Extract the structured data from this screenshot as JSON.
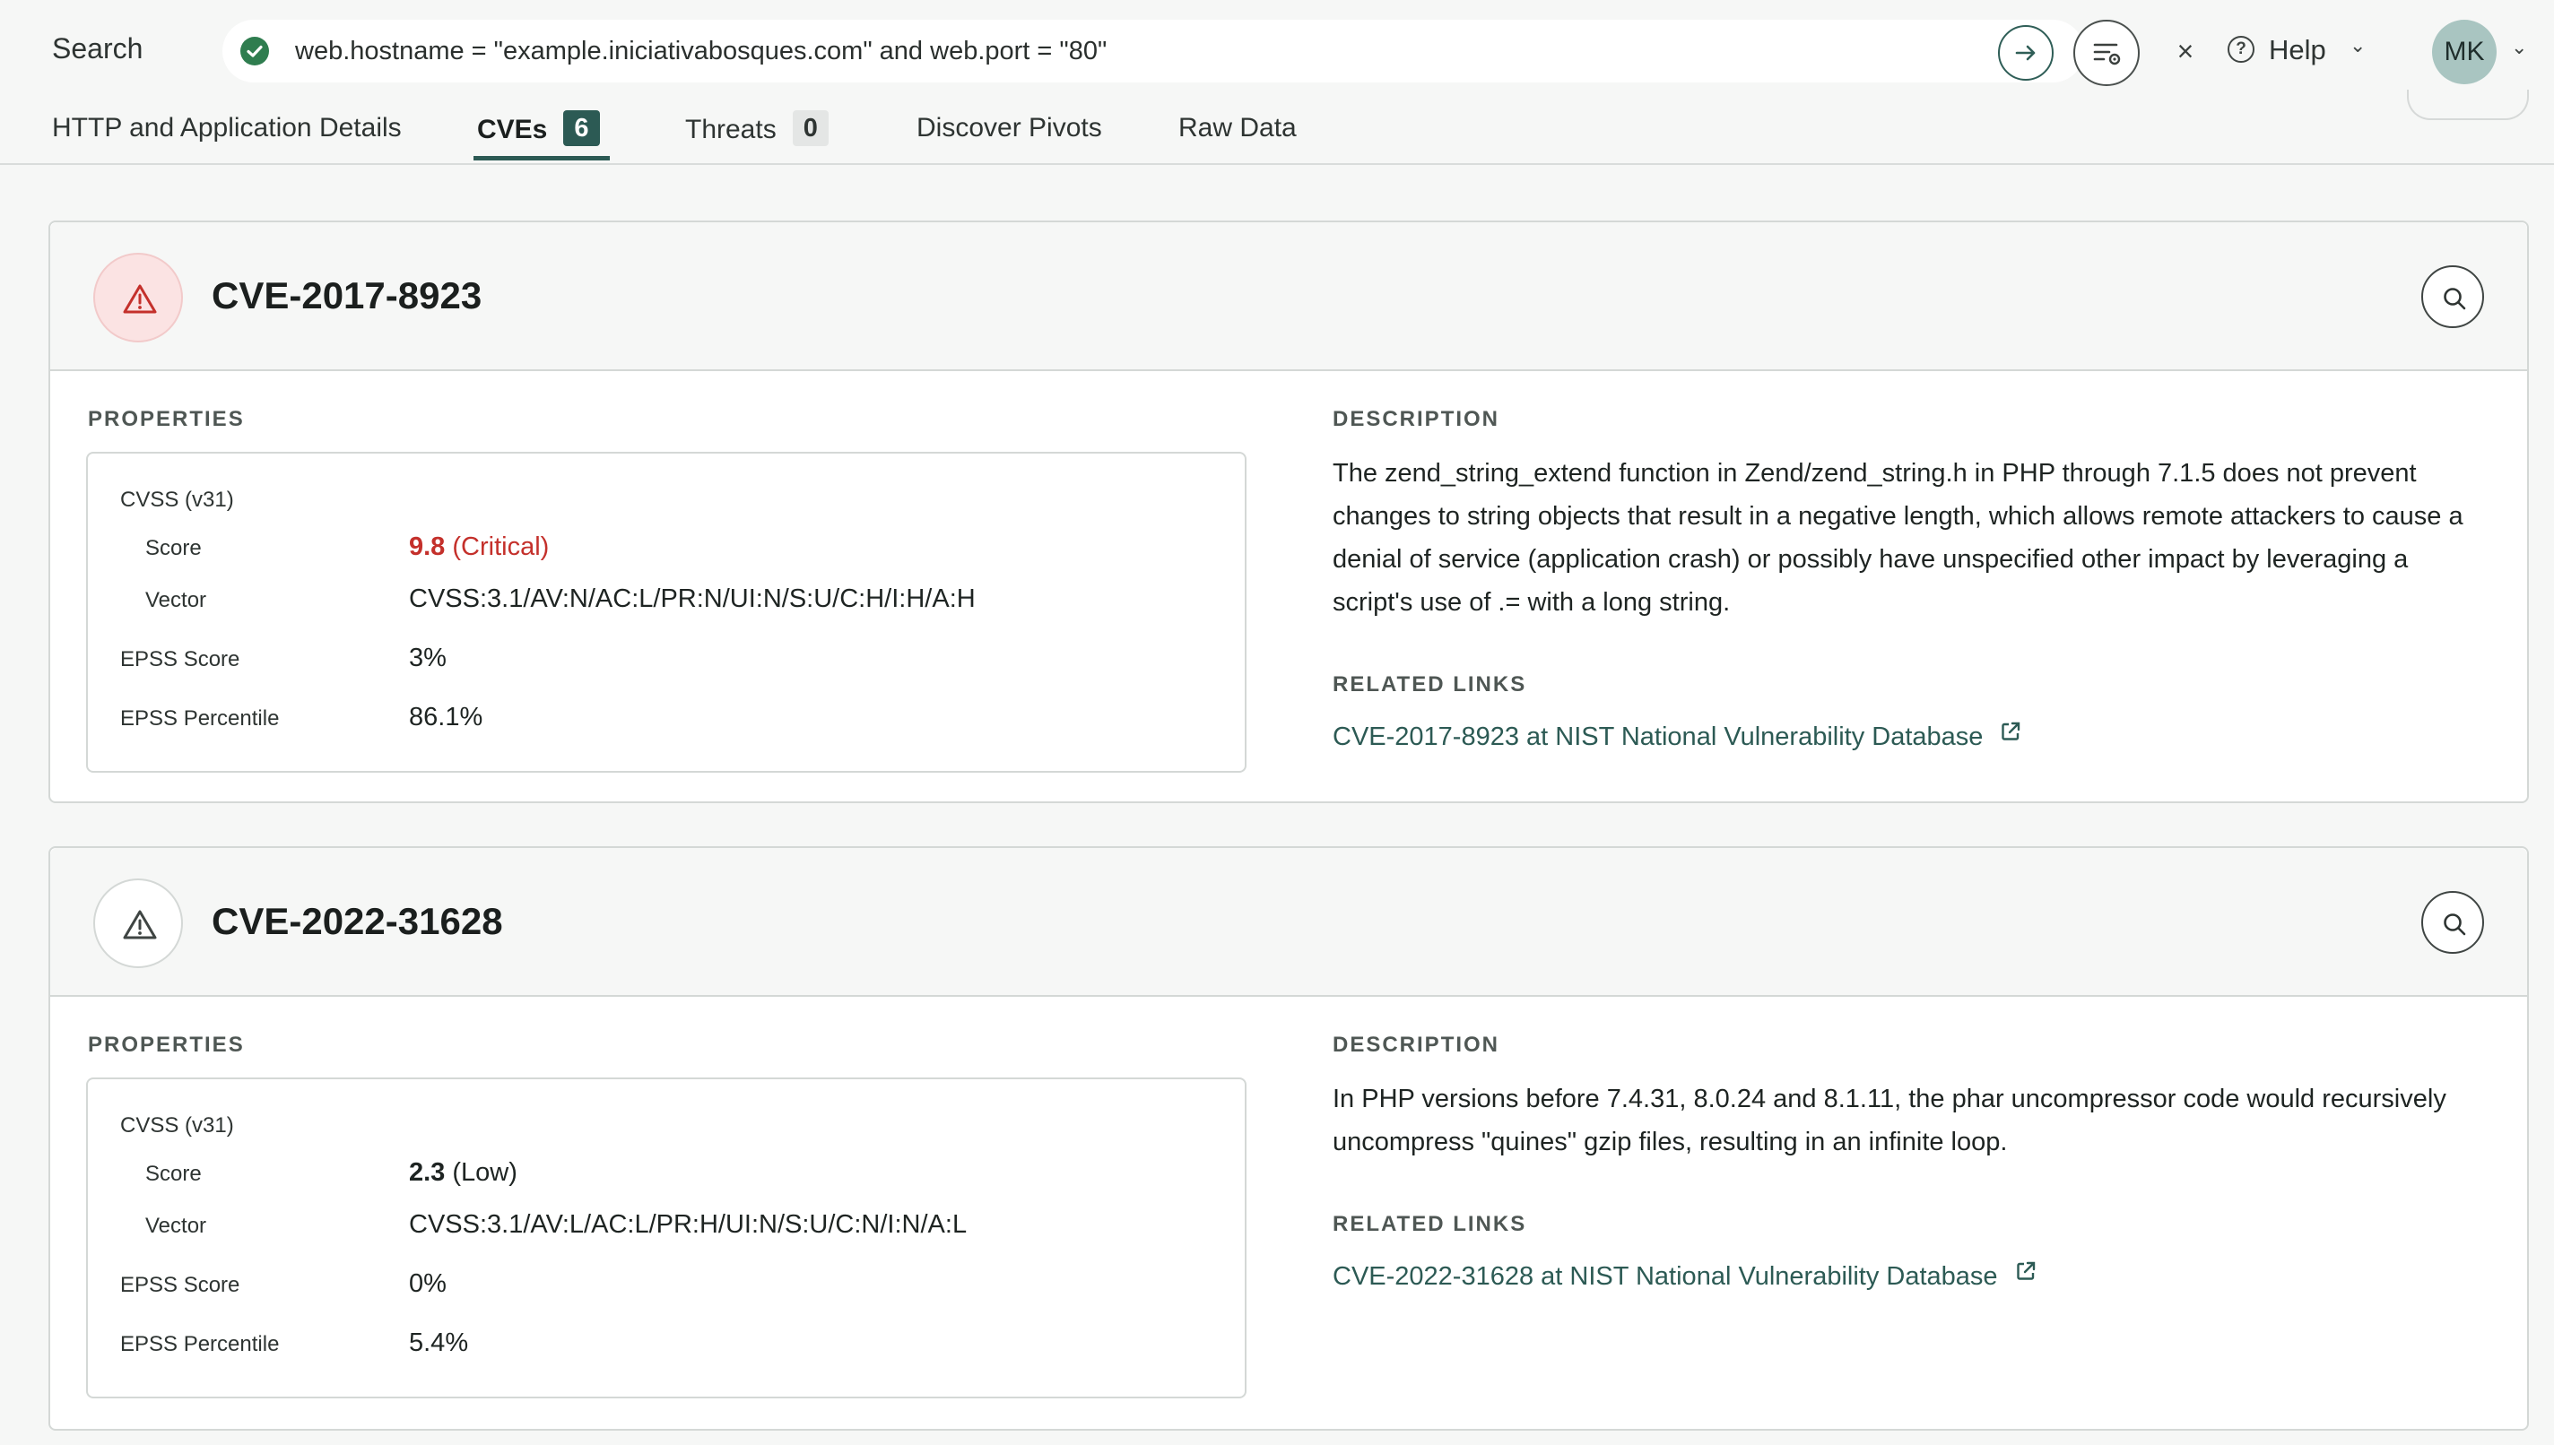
{
  "header": {
    "search_label": "Search",
    "query": "web.hostname = \"example.iniciativabosques.com\" and web.port = \"80\"",
    "clear_symbol": "×",
    "help_label": "Help",
    "avatar_initials": "MK"
  },
  "tabs": [
    {
      "label": "HTTP and Application Details"
    },
    {
      "label": "CVEs",
      "count": "6"
    },
    {
      "label": "Threats",
      "count": "0"
    },
    {
      "label": "Discover Pivots"
    },
    {
      "label": "Raw Data"
    }
  ],
  "labels": {
    "properties": "PROPERTIES",
    "description": "DESCRIPTION",
    "related_links": "RELATED LINKS",
    "cvss_group": "CVSS (v31)",
    "score": "Score",
    "vector": "Vector",
    "epss_score": "EPSS Score",
    "epss_percentile": "EPSS Percentile"
  },
  "cves": [
    {
      "id": "CVE-2017-8923",
      "severity_color": "#c4302b",
      "score_value": "9.8",
      "score_rating": "(Critical)",
      "vector": "CVSS:3.1/AV:N/AC:L/PR:N/UI:N/S:U/C:H/I:H/A:H",
      "epss_score": "3%",
      "epss_percentile": "86.1%",
      "description": "The zend_string_extend function in Zend/zend_string.h in PHP through 7.1.5 does not prevent changes to string objects that result in a negative length, which allows remote attackers to cause a denial of service (application crash) or possibly have unspecified other impact by leveraging a script's use of .= with a long string.",
      "link": "CVE-2017-8923 at NIST National Vulnerability Database"
    },
    {
      "id": "CVE-2022-31628",
      "severity_color": "#3f4543",
      "score_value": "2.3",
      "score_rating": "(Low)",
      "vector": "CVSS:3.1/AV:L/AC:L/PR:H/UI:N/S:U/C:N/I:N/A:L",
      "epss_score": "0%",
      "epss_percentile": "5.4%",
      "description": "In PHP versions before 7.4.31, 8.0.24 and 8.1.11, the phar uncompressor code would recursively uncompress \"quines\" gzip files, resulting in an infinite loop.",
      "link": "CVE-2022-31628 at NIST National Vulnerability Database"
    }
  ],
  "colors": {
    "accent": "#2c5a54",
    "critical": "#c4302b",
    "success": "#2f7d4f"
  }
}
